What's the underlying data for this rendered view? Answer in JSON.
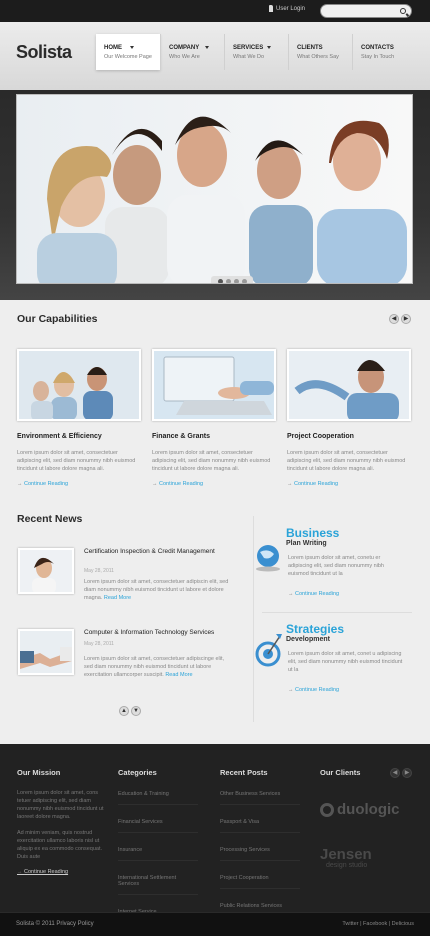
{
  "topbar": {
    "login": "User Login",
    "search_placeholder": ""
  },
  "brand": {
    "logo": "Solista"
  },
  "nav": [
    {
      "label": "HOME",
      "sub": "Our Welcome Page"
    },
    {
      "label": "COMPANY",
      "sub": "Who We Are"
    },
    {
      "label": "SERVICES",
      "sub": "What We Do"
    },
    {
      "label": "CLIENTS",
      "sub": "What Others Say"
    },
    {
      "label": "CONTACTS",
      "sub": "Stay In Touch"
    }
  ],
  "capabilities": {
    "title": "Our Capabilities",
    "items": [
      {
        "title": "Environment & Efficiency",
        "text": "Lorem ipsum dolor sit amet, consectetuer adipiscing elit, sed diam nonummy nibh euismod tincidunt ut labore dolore magna ali.",
        "more": "Continue Reading"
      },
      {
        "title": "Finance & Grants",
        "text": "Lorem ipsum dolor sit amet, consectetuer adipiscing elit, sed diam nonummy nibh euismod tincidunt ut labore dolore magna ali.",
        "more": "Continue Reading"
      },
      {
        "title": "Project Cooperation",
        "text": "Lorem ipsum dolor sit amet, consectetuer adipiscing elit, sed diam nonummy nibh euismod tincidunt ut labore dolore magna ali.",
        "more": "Continue Reading"
      }
    ]
  },
  "news": {
    "title": "Recent News",
    "items": [
      {
        "title": "Certification Inspection & Credit Management",
        "date": "May 28, 2011",
        "text": "Lorem ipsum dolor sit amet, consectetuer adipiscin elit, sed diam nonummy nibh euismod tincidunt ut labore et dolore magna.",
        "more": "Read More"
      },
      {
        "title": "Computer & Information Technology Services",
        "date": "May 28, 2011",
        "text": "Lorem ipsum dolor sit amet, consectetuer adipiscinge elit, sed diam nonummy nibh euismod tincidunt ut labore exercitation ullamcorper suscipit.",
        "more": "Read More"
      }
    ]
  },
  "side": [
    {
      "big": "Business",
      "sub": "Plan Writing",
      "text": "Lorem ipsum dolor sit amet, conetu er adipiscing elit, sed diam nonummy nibh euismod tincidunt ut la",
      "more": "Continue Reading"
    },
    {
      "big": "Strategies",
      "sub": "Development",
      "text": "Lorem ipsum dolor sit amet, conet u adipiscing elit, sed diam nonummy nibh euismod tincidunt ut la",
      "more": "Continue Reading"
    }
  ],
  "footer": {
    "mission": {
      "title": "Our Mission",
      "text1": "Lorem ipsum dolor sit amet, cons tetuer adipiscing elit, sed diam nonummy nibh euismod tincidunt ut laoreet dolore magna.",
      "text2": "Ad minim veniam, quis nostrud exercitation ullamco laboris nisl ut aliquip ex ea commodo consequat. Duis aute",
      "more": "Continue Reading"
    },
    "categories": {
      "title": "Categories",
      "items": [
        "Education & Training",
        "Financial Services",
        "Insurance",
        "International Settlement Services",
        "Internet Service"
      ]
    },
    "posts": {
      "title": "Recent Posts",
      "items": [
        "Other Business Services",
        "Passport & Visa",
        "Processing Services",
        "Project Cooperation",
        "Public Relations Services"
      ]
    },
    "clients": {
      "title": "Our Clients",
      "logo1": "duologic",
      "logo2": "Jensen",
      "logo2_sub": "design studio"
    }
  },
  "bottom": {
    "copyright": "Solista © 2011 Privacy Policy",
    "social": "Twitter  |  Facebook  |  Delicious"
  },
  "colors": {
    "accent": "#2aa3d8",
    "dark": "#222222"
  }
}
